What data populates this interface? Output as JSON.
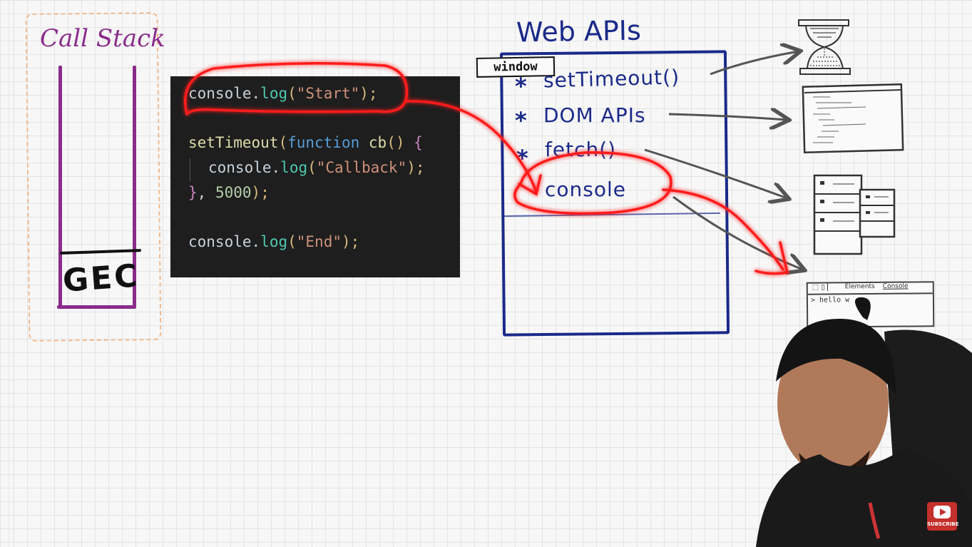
{
  "call_stack": {
    "title": "Call Stack",
    "frame_label": "GEC"
  },
  "code": {
    "line1": {
      "obj": "console",
      "dot": ".",
      "method": "log",
      "open": "(",
      "str": "\"Start\"",
      "close": ");"
    },
    "line2": {
      "fn": "setTimeout",
      "open": "(",
      "kw": "function",
      "name": "cb",
      "parens": "()",
      "brace": "{"
    },
    "line3": {
      "obj": "console",
      "dot": ".",
      "method": "log",
      "open": "(",
      "str": "\"Callback\"",
      "close": ");"
    },
    "line4": {
      "brace": "}",
      "punc": ",",
      "num": "5000",
      "close": ");"
    },
    "line5": {
      "obj": "console",
      "dot": ".",
      "method": "log",
      "open": "(",
      "str": "\"End\"",
      "close": ");"
    }
  },
  "web_apis": {
    "title": "Web APIs",
    "window_label": "window",
    "items": [
      "setTimeout()",
      "DOM APIs",
      "fetch()",
      "console"
    ]
  },
  "devtools_sketch": {
    "tab_elements": "Elements",
    "tab_console": "Console",
    "output": "> hello w"
  },
  "subscribe": {
    "label": "SUBSCRIBE"
  },
  "colors": {
    "call_stack": "#8a2c8a",
    "web_apis": "#1a2a8a",
    "highlight": "#ff1a1a",
    "editor_bg": "#1e1e1e"
  }
}
